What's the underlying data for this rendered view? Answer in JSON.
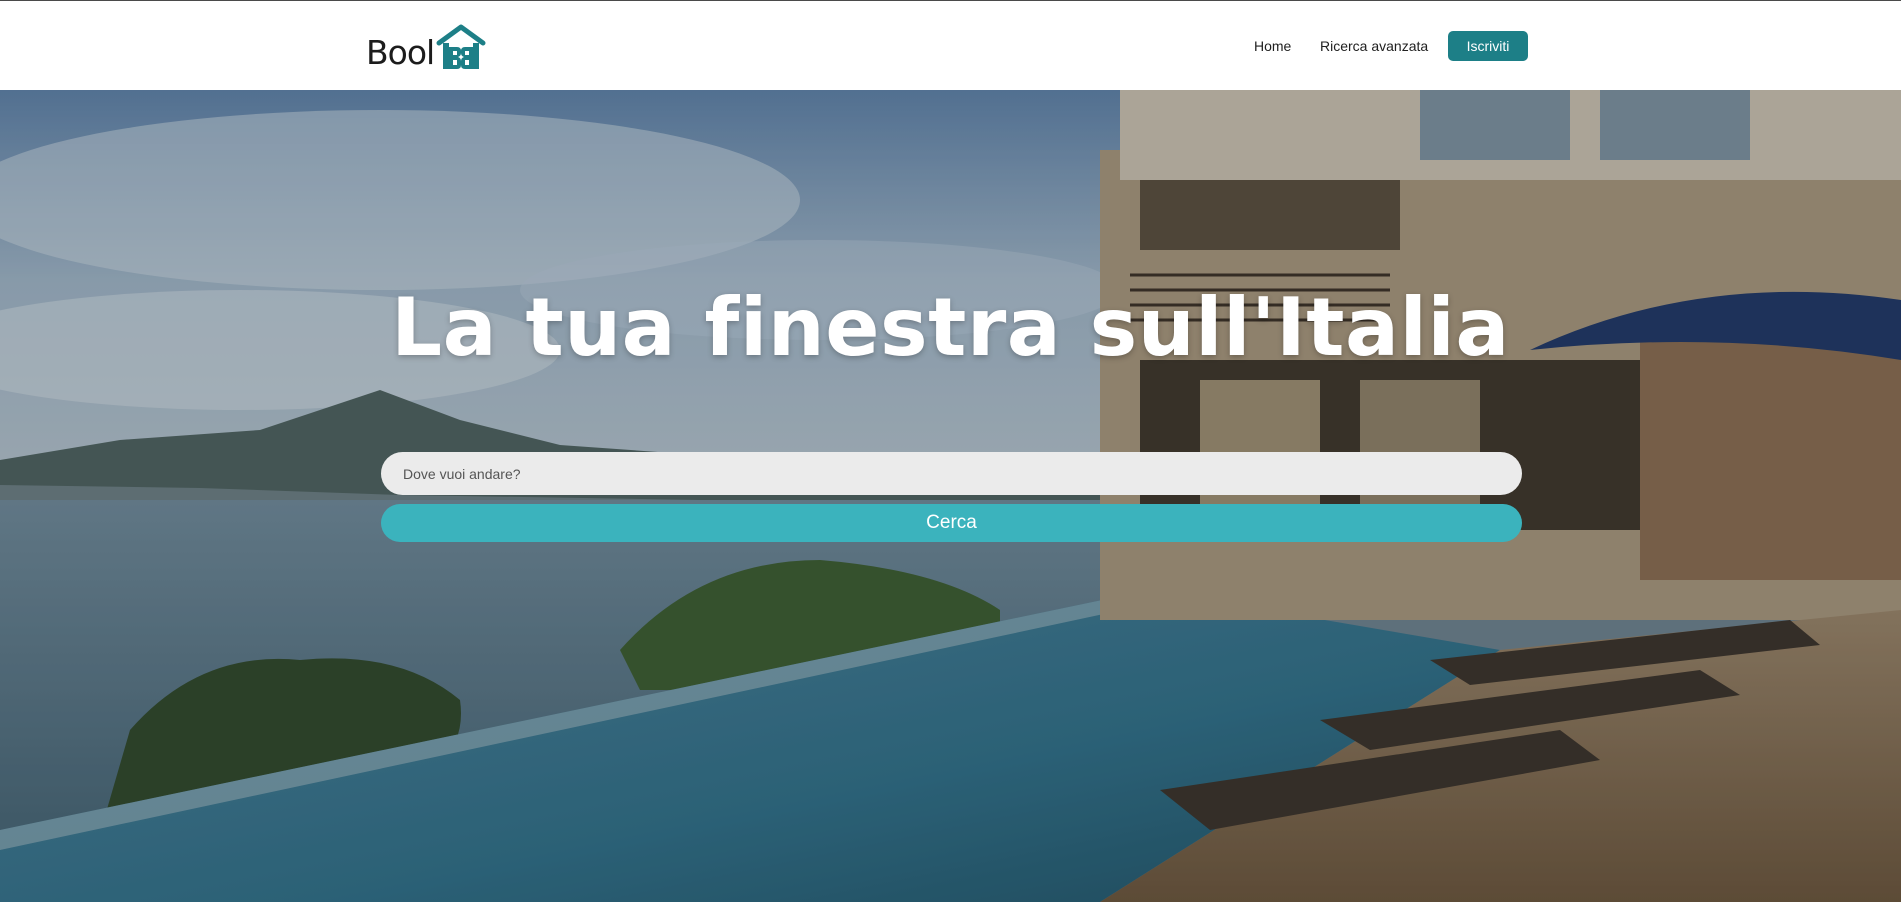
{
  "brand": {
    "name": "Bool",
    "accent_color": "#1d7f87",
    "icon": "house-b-icon"
  },
  "nav": {
    "home_label": "Home",
    "advanced_search_label": "Ricerca avanzata",
    "signup_label": "Iscriviti"
  },
  "hero": {
    "title": "La tua finestra sull'Italia",
    "background": "villa-pool-sea-photo"
  },
  "search": {
    "placeholder": "Dove vuoi andare?",
    "value": "",
    "button_label": "Cerca",
    "button_color": "#3bb3bd"
  }
}
